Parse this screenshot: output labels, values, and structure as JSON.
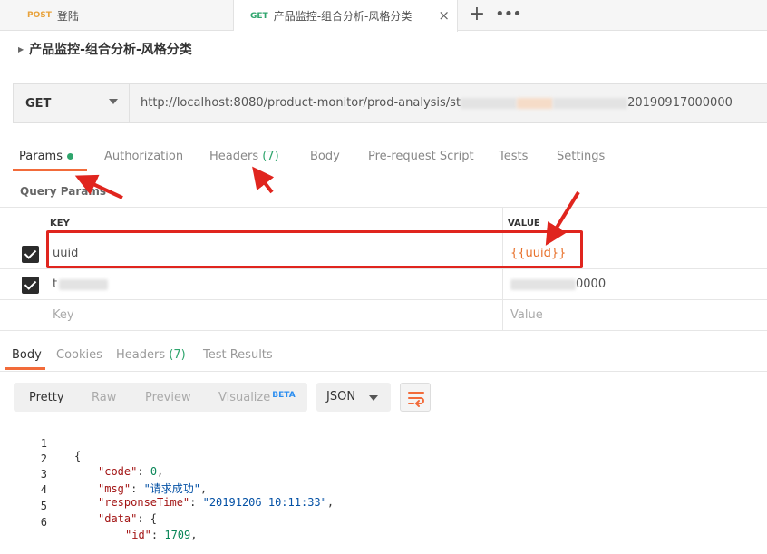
{
  "tabs": [
    {
      "method": "POST",
      "label": "登陆"
    },
    {
      "method": "GET",
      "label": "产品监控-组合分析-风格分类",
      "close": "×"
    }
  ],
  "tab_actions": {
    "new": "+",
    "more": "•••"
  },
  "request": {
    "title": "产品监控-组合分析-风格分类",
    "method": "GET",
    "url_prefix": "http://localhost:8080/product-monitor/prod-analysis/st",
    "url_suffix": "20190917000000"
  },
  "request_tabs": {
    "params": "Params",
    "authorization": "Authorization",
    "headers": "Headers",
    "headers_count": "(7)",
    "body": "Body",
    "prerequest": "Pre-request Script",
    "tests": "Tests",
    "settings": "Settings"
  },
  "params": {
    "section_label": "Query Params",
    "columns": {
      "key": "KEY",
      "value": "VALUE"
    },
    "rows": [
      {
        "key": "uuid",
        "value": "{{uuid}}",
        "checked": true
      },
      {
        "key": "t",
        "value": "0000",
        "checked": true
      }
    ],
    "placeholder": {
      "key": "Key",
      "value": "Value"
    }
  },
  "response_tabs": {
    "body": "Body",
    "cookies": "Cookies",
    "headers": "Headers",
    "headers_count": "(7)",
    "test_results": "Test Results"
  },
  "response_toolbar": {
    "pretty": "Pretty",
    "raw": "Raw",
    "preview": "Preview",
    "visualize": "Visualize",
    "beta": "BETA",
    "format": "JSON"
  },
  "response_body": {
    "line_numbers": [
      "1",
      "2",
      "3",
      "4",
      "5",
      "6"
    ],
    "open_brace": "{",
    "code_key": "\"code\"",
    "code_val": "0",
    "msg_key": "\"msg\"",
    "msg_val": "\"请求成功\"",
    "rt_key": "\"responseTime\"",
    "rt_val": "\"20191206 10:11:33\"",
    "data_key": "\"data\"",
    "id_key": "\"id\"",
    "id_val": "1709"
  },
  "colors": {
    "accent": "#f26b3a",
    "get": "#2fa56d",
    "post": "#e8a33d",
    "variable": "#e8702a",
    "annotation": "#e0251e"
  }
}
